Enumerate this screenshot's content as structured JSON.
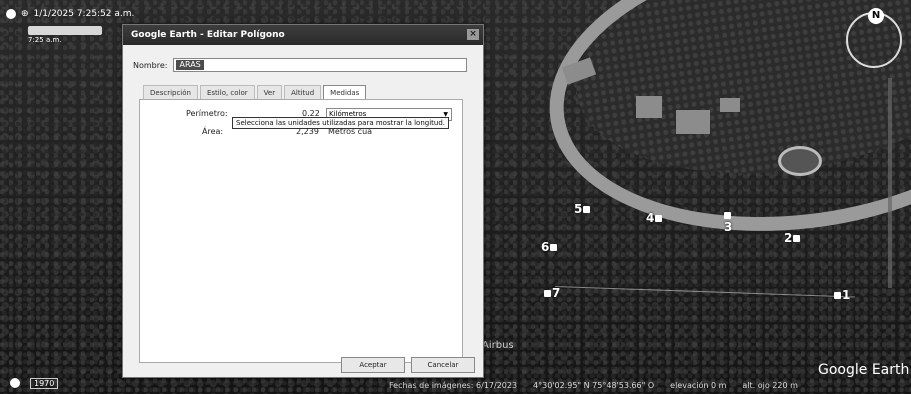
{
  "window": {
    "title": "Google Earth - Editar Polígono",
    "close_glyph": "×"
  },
  "topbar": {
    "date_time": "1/1/2025  7:25:52 a.m.",
    "small_time": "7:25 a.m."
  },
  "name_field": {
    "label": "Nombre:",
    "value": "ARAS"
  },
  "tabs": [
    {
      "label": "Descripción"
    },
    {
      "label": "Estilo, color"
    },
    {
      "label": "Ver"
    },
    {
      "label": "Altitud"
    },
    {
      "label": "Medidas"
    }
  ],
  "measures": {
    "perimeter_label": "Perímetro:",
    "perimeter_value": "0.22",
    "perimeter_unit": "Kilómetros",
    "area_label": "Área:",
    "area_value": "2,239",
    "area_unit": "Metros cua"
  },
  "tooltip": "Selecciona las unidades utilizadas para mostrar la longitud.",
  "buttons": {
    "accept": "Aceptar",
    "cancel": "Cancelar"
  },
  "map": {
    "markers": [
      "5",
      "4",
      "3",
      "2",
      "6",
      "7",
      "1"
    ],
    "airbus": "Airbus",
    "brand": "Google Earth",
    "north": "N",
    "year": "1970"
  },
  "status": {
    "imagery_date": "Fechas de imágenes: 6/17/2023",
    "coords": "4°30'02.95\" N   75°48'53.66\" O",
    "elevation": "elevación    0 m",
    "eye_alt": "alt. ojo   220 m"
  }
}
